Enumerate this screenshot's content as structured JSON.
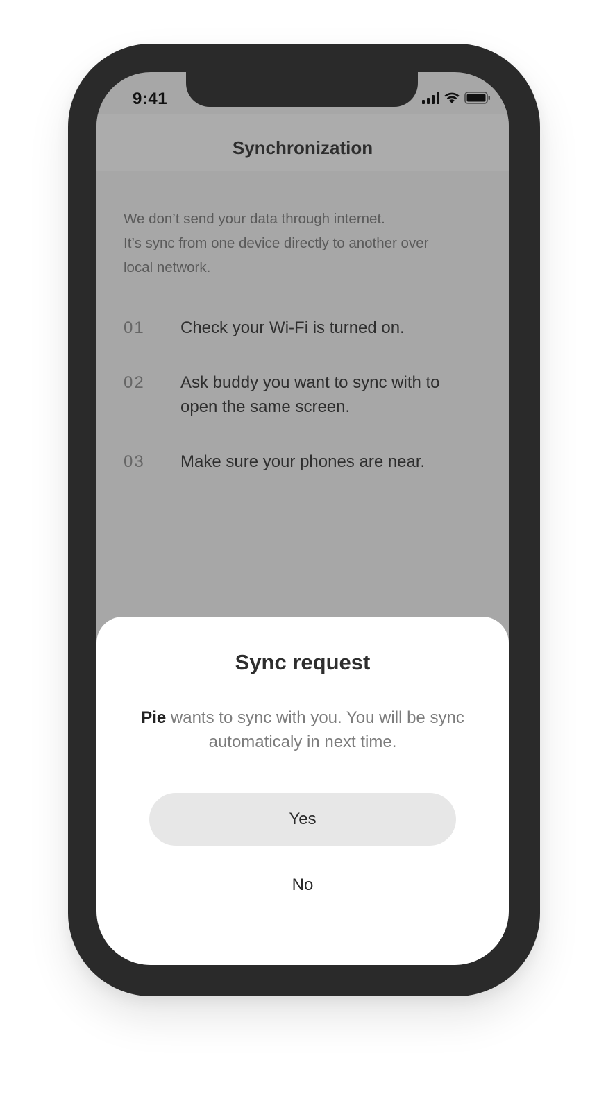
{
  "status_bar": {
    "time": "9:41",
    "icons": [
      "cellular-signal-icon",
      "wifi-icon",
      "battery-icon"
    ]
  },
  "header": {
    "title": "Synchronization"
  },
  "intro": {
    "lines": [
      "We don’t send your data through internet.",
      "It’s sync from one device directly to another over",
      "local network."
    ]
  },
  "steps": [
    {
      "number": "01",
      "text": "Check your Wi-Fi is turned on."
    },
    {
      "number": "02",
      "text": "Ask buddy you want to sync with to open the same screen."
    },
    {
      "number": "03",
      "text": "Make sure your phones are near."
    }
  ],
  "dialog": {
    "title": "Sync request",
    "sender": "Pie",
    "message": "wants to sync with you. You will be sync automaticaly in next time.",
    "yes_label": "Yes",
    "no_label": "No"
  },
  "colors": {
    "frame": "#2a2a2a",
    "dimmed_background": "#a7a7a7",
    "sheet": "#ffffff",
    "primary_button": "#e7e7e7",
    "text_dark": "#2e2e2e",
    "text_muted": "#7c7c7c"
  }
}
